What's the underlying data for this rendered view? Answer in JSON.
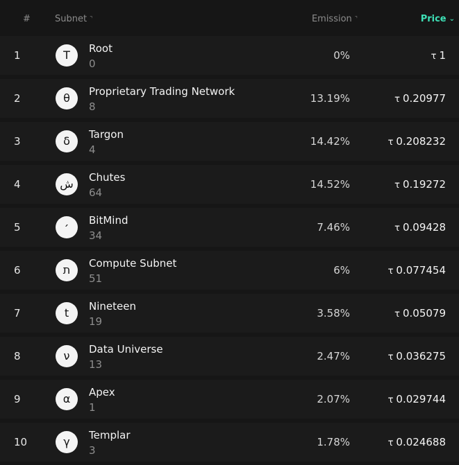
{
  "header": {
    "num_label": "#",
    "subnet_label": "Subnet",
    "emission_label": "Emission",
    "price_label": "Price",
    "sort_icon": "sort-neutral-icon",
    "active_sort_icon": "chevron-down-icon",
    "accent_color": "#3ee0b6"
  },
  "currency_symbol": "τ",
  "rows": [
    {
      "rank": "1",
      "icon": "Τ",
      "name": "Root",
      "netuid": "0",
      "emission": "0%",
      "price": "1"
    },
    {
      "rank": "2",
      "icon": "θ",
      "name": "Proprietary Trading Network",
      "netuid": "8",
      "emission": "13.19%",
      "price": "0.20977"
    },
    {
      "rank": "3",
      "icon": "δ",
      "name": "Targon",
      "netuid": "4",
      "emission": "14.42%",
      "price": "0.208232"
    },
    {
      "rank": "4",
      "icon": "ش",
      "name": "Chutes",
      "netuid": "64",
      "emission": "14.52%",
      "price": "0.19272"
    },
    {
      "rank": "5",
      "icon": "׳",
      "name": "BitMind",
      "netuid": "34",
      "emission": "7.46%",
      "price": "0.09428"
    },
    {
      "rank": "6",
      "icon": "ת",
      "name": "Compute Subnet",
      "netuid": "51",
      "emission": "6%",
      "price": "0.077454"
    },
    {
      "rank": "7",
      "icon": "t",
      "name": "Nineteen",
      "netuid": "19",
      "emission": "3.58%",
      "price": "0.05079"
    },
    {
      "rank": "8",
      "icon": "ν",
      "name": "Data Universe",
      "netuid": "13",
      "emission": "2.47%",
      "price": "0.036275"
    },
    {
      "rank": "9",
      "icon": "α",
      "name": "Apex",
      "netuid": "1",
      "emission": "2.07%",
      "price": "0.029744"
    },
    {
      "rank": "10",
      "icon": "γ",
      "name": "Templar",
      "netuid": "3",
      "emission": "1.78%",
      "price": "0.024688"
    }
  ]
}
